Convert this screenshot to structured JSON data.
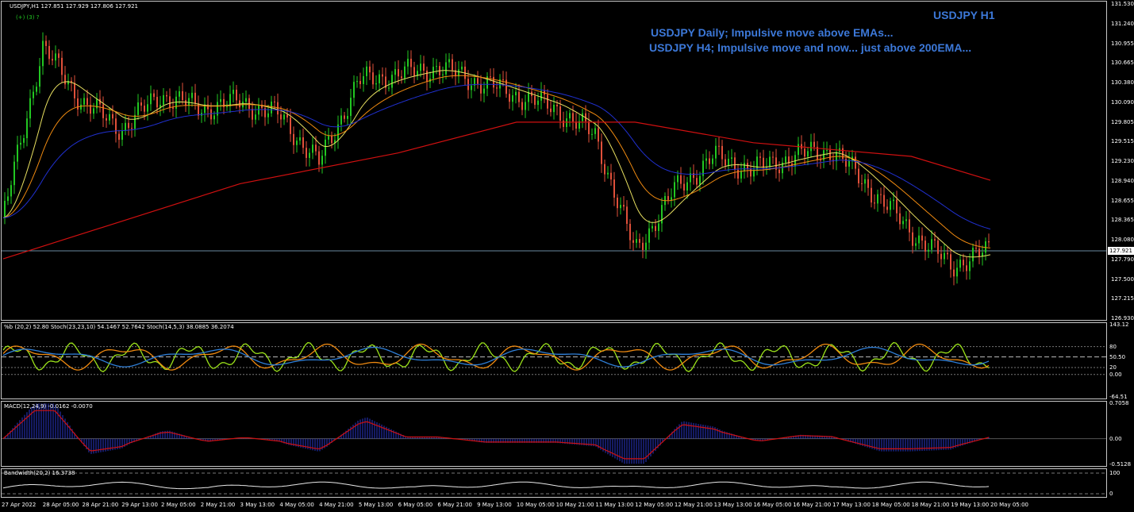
{
  "header": {
    "symbol_line": "USDJPY,H1  127.851 127.929 127.806 127.921",
    "indicator_note": "(+) (3) ?"
  },
  "annotations": {
    "title": "USDJPY H1",
    "line1": "USDJPY Daily; Impulsive move above EMAs...",
    "line2": "USDJPY H4; Impulsive move and now... just above 200EMA..."
  },
  "panels": {
    "stoch_label": "%b (20,2) 52.80  Stoch(23,23,10) 54.1467 52.7642  Stoch(14,5,3) 38.0885 36.2074",
    "macd_label": "MACD(12,24,9) -0.0162 -0.0070",
    "bandwidth_label": "Bandwidth(20,2) 16.3738"
  },
  "colors": {
    "accent_text": "#3c78d8",
    "bull": "#22c722",
    "bear": "#e0503a",
    "ema200": "#d01010",
    "ema_blue": "#2030d0",
    "ema_yellow": "#e8e060",
    "orange": "#f08a10"
  },
  "chart_data": [
    {
      "type": "candlestick",
      "name": "price",
      "current_price": "127.921",
      "y_ticks": [
        "131.530",
        "131.240",
        "130.955",
        "130.665",
        "130.380",
        "130.090",
        "129.805",
        "129.515",
        "129.230",
        "128.940",
        "128.655",
        "128.365",
        "128.080",
        "127.790",
        "127.500",
        "127.215",
        "126.930"
      ],
      "ylim": [
        126.93,
        131.53
      ],
      "x_ticks": [
        "27 Apr 2022",
        "28 Apr 05:00",
        "28 Apr 21:00",
        "29 Apr 13:00",
        "2 May 05:00",
        "2 May 21:00",
        "3 May 13:00",
        "4 May 05:00",
        "4 May 21:00",
        "5 May 13:00",
        "6 May 05:00",
        "6 May 21:00",
        "9 May 13:00",
        "10 May 05:00",
        "10 May 21:00",
        "11 May 13:00",
        "12 May 05:00",
        "12 May 21:00",
        "13 May 13:00",
        "16 May 05:00",
        "16 May 21:00",
        "17 May 13:00",
        "18 May 05:00",
        "18 May 21:00",
        "19 May 13:00",
        "20 May 05:00"
      ],
      "close_path": [
        {
          "x": "27 Apr 2022",
          "y": 128.4
        },
        {
          "x": "28 Apr 05:00",
          "y": 130.9
        },
        {
          "x": "28 Apr 21:00",
          "y": 130.1
        },
        {
          "x": "29 Apr 13:00",
          "y": 129.7
        },
        {
          "x": "2 May 05:00",
          "y": 130.2
        },
        {
          "x": "2 May 21:00",
          "y": 130.0
        },
        {
          "x": "3 May 13:00",
          "y": 130.1
        },
        {
          "x": "4 May 05:00",
          "y": 129.9
        },
        {
          "x": "4 May 21:00",
          "y": 129.2
        },
        {
          "x": "5 May 13:00",
          "y": 130.4
        },
        {
          "x": "6 May 05:00",
          "y": 130.5
        },
        {
          "x": "6 May 21:00",
          "y": 130.6
        },
        {
          "x": "9 May 13:00",
          "y": 130.4
        },
        {
          "x": "10 May 05:00",
          "y": 130.2
        },
        {
          "x": "10 May 21:00",
          "y": 130.0
        },
        {
          "x": "11 May 13:00",
          "y": 129.6
        },
        {
          "x": "12 May 05:00",
          "y": 127.9
        },
        {
          "x": "12 May 21:00",
          "y": 128.8
        },
        {
          "x": "13 May 13:00",
          "y": 129.3
        },
        {
          "x": "16 May 05:00",
          "y": 129.1
        },
        {
          "x": "16 May 21:00",
          "y": 129.3
        },
        {
          "x": "17 May 13:00",
          "y": 129.4
        },
        {
          "x": "18 May 05:00",
          "y": 128.8
        },
        {
          "x": "18 May 21:00",
          "y": 128.2
        },
        {
          "x": "19 May 13:00",
          "y": 127.7
        },
        {
          "x": "20 May 05:00",
          "y": 127.92
        }
      ],
      "ema200": [
        {
          "x": "27 Apr 2022",
          "y": 127.8
        },
        {
          "x": "3 May 13:00",
          "y": 128.9
        },
        {
          "x": "6 May 05:00",
          "y": 129.35
        },
        {
          "x": "10 May 05:00",
          "y": 129.8
        },
        {
          "x": "12 May 05:00",
          "y": 129.8
        },
        {
          "x": "16 May 05:00",
          "y": 129.5
        },
        {
          "x": "18 May 21:00",
          "y": 129.3
        },
        {
          "x": "20 May 05:00",
          "y": 128.95
        }
      ]
    },
    {
      "type": "line",
      "name": "stochastic",
      "y_ticks": [
        "143.12",
        "80",
        "50.50",
        "20",
        "0.00",
        "-64.51"
      ],
      "ylim": [
        -64.51,
        143.12
      ]
    },
    {
      "type": "bar",
      "name": "macd",
      "y_ticks": [
        "0.7058",
        "0.00",
        "-0.5128"
      ],
      "ylim": [
        -0.5128,
        0.7058
      ]
    },
    {
      "type": "line",
      "name": "bandwidth",
      "y_ticks": [
        "100",
        "0"
      ],
      "ylim": [
        0,
        100
      ]
    }
  ]
}
